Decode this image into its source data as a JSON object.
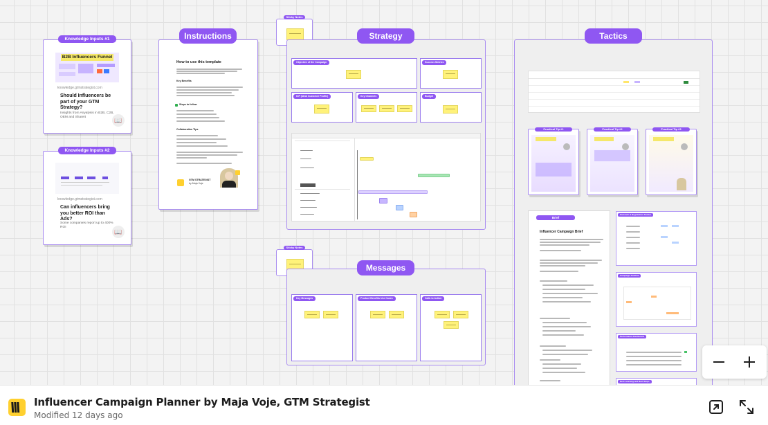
{
  "board": {
    "title": "Influencer Campaign Planner by Maja Voje, GTM Strategist",
    "modified": "Modified 12 days ago",
    "logo_icon": "miro-logo",
    "accent_color": "#8f57f2",
    "sticky_color": "#fff27a"
  },
  "frames": {
    "knowledge1": {
      "label": "Knowledge Inputs #1",
      "image_title": "B2B Influencers Funnel",
      "domain": "knowledge.gtmstrategist.com",
      "heading": "Should Influencers be part of your GTM Strategy?",
      "sub": "Insights from Anyalysis in B2B, C2B, OEM and ShareIt"
    },
    "knowledge2": {
      "label": "Knowledge Inputs #2",
      "domain": "knowledge.gtmstrategist.com",
      "heading": "Can influencers bring you better ROI than Ads?",
      "sub": "Some companies report up to 400% ROI"
    },
    "instructions": {
      "label": "Instructions",
      "title": "How to use this template",
      "s1": "Key Benefits",
      "s2": "Steps to follow",
      "s3": "Collaboration Tips",
      "brand": "GTM STRATEGIST",
      "author": "by Maja Voje"
    },
    "sticky1": {
      "label": "Sticky Notes"
    },
    "sticky2": {
      "label": "Sticky Notes"
    },
    "strategy": {
      "label": "Strategy",
      "sub1": "Objective of the Campaign",
      "sub2": "Success Metrics",
      "sub3": "ICP (Ideal Customer Profile)",
      "sub4": "Key Channels",
      "sub5": "Budget"
    },
    "messages": {
      "label": "Messages",
      "sub1": "Key Messages",
      "sub2": "Product Benefits Use Cases",
      "sub3": "Calls to Action"
    },
    "tactics": {
      "label": "Tactics",
      "tip1": "Practical Tip #1",
      "tip2": "Practical Tip #2",
      "tip3": "Practical Tip #3",
      "brief_label": "Brief",
      "brief_title": "Influencer Campaign Brief",
      "tracker": "Outreach & Negotiation Tracker",
      "timeline": "Campaign Timeline",
      "dashboard": "Performance Dashboard",
      "bottom": "Next Learning and Next Steps"
    }
  },
  "controls": {
    "zoom_out_icon": "minus-icon",
    "zoom_in_icon": "plus-icon",
    "open_icon": "open-external-icon",
    "fullscreen_icon": "fullscreen-icon"
  }
}
